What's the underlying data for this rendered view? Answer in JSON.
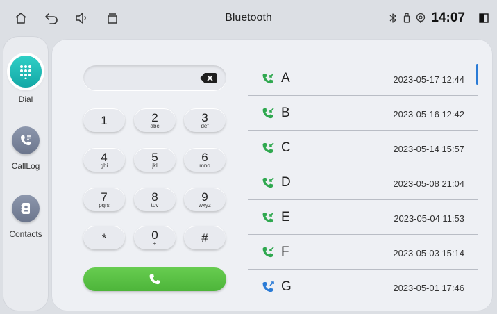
{
  "statusbar": {
    "title": "Bluetooth",
    "time": "14:07",
    "icons": [
      "home-icon",
      "back-icon",
      "volume-icon",
      "recent-apps-icon",
      "bluetooth-icon",
      "usb-icon",
      "location-icon",
      "split-screen-icon"
    ]
  },
  "sidebar": {
    "items": [
      {
        "label": "Dial",
        "icon": "dialpad-icon",
        "active": true
      },
      {
        "label": "CallLog",
        "icon": "call-log-icon",
        "active": false
      },
      {
        "label": "Contacts",
        "icon": "contacts-icon",
        "active": false
      }
    ]
  },
  "dialer": {
    "number": "",
    "keys": [
      {
        "digit": "1",
        "letters": ""
      },
      {
        "digit": "2",
        "letters": "abc"
      },
      {
        "digit": "3",
        "letters": "def"
      },
      {
        "digit": "4",
        "letters": "ghi"
      },
      {
        "digit": "5",
        "letters": "jkl"
      },
      {
        "digit": "6",
        "letters": "mno"
      },
      {
        "digit": "7",
        "letters": "pqrs"
      },
      {
        "digit": "8",
        "letters": "tuv"
      },
      {
        "digit": "9",
        "letters": "wxyz"
      },
      {
        "digit": "*",
        "letters": ""
      },
      {
        "digit": "0",
        "letters": "+"
      },
      {
        "digit": "#",
        "letters": ""
      }
    ]
  },
  "calllog": {
    "entries": [
      {
        "name": "A",
        "datetime": "2023-05-17  12:44",
        "type": "incoming",
        "color": "#2fa84f"
      },
      {
        "name": "B",
        "datetime": "2023-05-16  12:42",
        "type": "incoming",
        "color": "#2fa84f"
      },
      {
        "name": "C",
        "datetime": "2023-05-14  15:57",
        "type": "incoming",
        "color": "#2fa84f"
      },
      {
        "name": "D",
        "datetime": "2023-05-08  21:04",
        "type": "incoming",
        "color": "#2fa84f"
      },
      {
        "name": "E",
        "datetime": "2023-05-04  11:53",
        "type": "incoming",
        "color": "#2fa84f"
      },
      {
        "name": "F",
        "datetime": "2023-05-03  15:14",
        "type": "incoming",
        "color": "#2fa84f"
      },
      {
        "name": "G",
        "datetime": "2023-05-01  17:46",
        "type": "outgoing",
        "color": "#2a7bd6"
      }
    ]
  },
  "colors": {
    "accent": "#1fbdb8",
    "call_green": "#56bd41",
    "incoming": "#2fa84f",
    "outgoing": "#2a7bd6"
  }
}
